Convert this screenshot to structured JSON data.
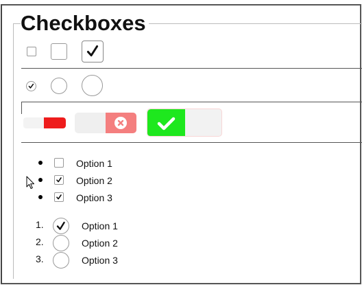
{
  "page": {
    "title": "Checkboxes"
  },
  "checkbox_row": [
    {
      "size": "small",
      "checked": false
    },
    {
      "size": "medium",
      "checked": false
    },
    {
      "size": "large",
      "checked": true
    }
  ],
  "radio_row": [
    {
      "size": "small",
      "checked": true
    },
    {
      "size": "medium",
      "checked": false
    },
    {
      "size": "large",
      "checked": false
    }
  ],
  "toggle_row": [
    {
      "size": "small",
      "state": "on"
    },
    {
      "size": "medium",
      "state": "off",
      "icon": "x-icon"
    },
    {
      "size": "large",
      "state": "on",
      "icon": "check-icon"
    }
  ],
  "bulleted_list": {
    "items": [
      {
        "label": "Option 1",
        "checked": false
      },
      {
        "label": "Option 2",
        "checked": true
      },
      {
        "label": "Option 3",
        "checked": true
      }
    ]
  },
  "numbered_list": {
    "items": [
      {
        "number": "1.",
        "label": "Option 1",
        "checked": true
      },
      {
        "number": "2.",
        "label": "Option 2",
        "checked": false
      },
      {
        "number": "3.",
        "label": "Option 3",
        "checked": false
      }
    ]
  },
  "colors": {
    "toggle_red": "#ee1c1c",
    "toggle_pink": "#f47f7f",
    "toggle_green": "#1ee81e"
  }
}
